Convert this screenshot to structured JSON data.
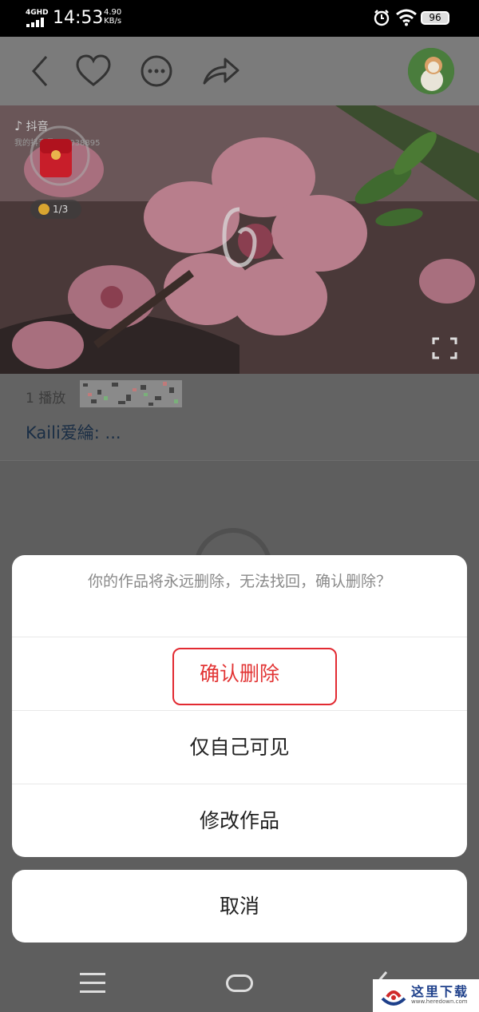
{
  "status_bar": {
    "network": "4GHD",
    "time": "14:53",
    "speed_value": "4.90",
    "speed_unit": "KB/s",
    "battery": "96"
  },
  "app_bar": {
    "icons": [
      "back-icon",
      "heart-icon",
      "more-icon",
      "share-icon"
    ],
    "avatar": "user-avatar"
  },
  "video": {
    "platform": "抖音",
    "user_id_partial": "我的抖音号: 74038895",
    "coin_progress": "1/3"
  },
  "post": {
    "play_count": "1 播放",
    "caption": "Kaili爱綸: ..."
  },
  "dialog": {
    "message": "你的作品将永远删除，无法找回，确认删除？",
    "options": [
      "确认删除",
      "仅自己可见",
      "修改作品"
    ],
    "cancel": "取消"
  },
  "watermark": {
    "text": "这里下载",
    "url": "www.heredown.com"
  },
  "colors": {
    "danger": "#e23434",
    "highlight_box": "#e22a32",
    "caption": "#1a2e45"
  }
}
